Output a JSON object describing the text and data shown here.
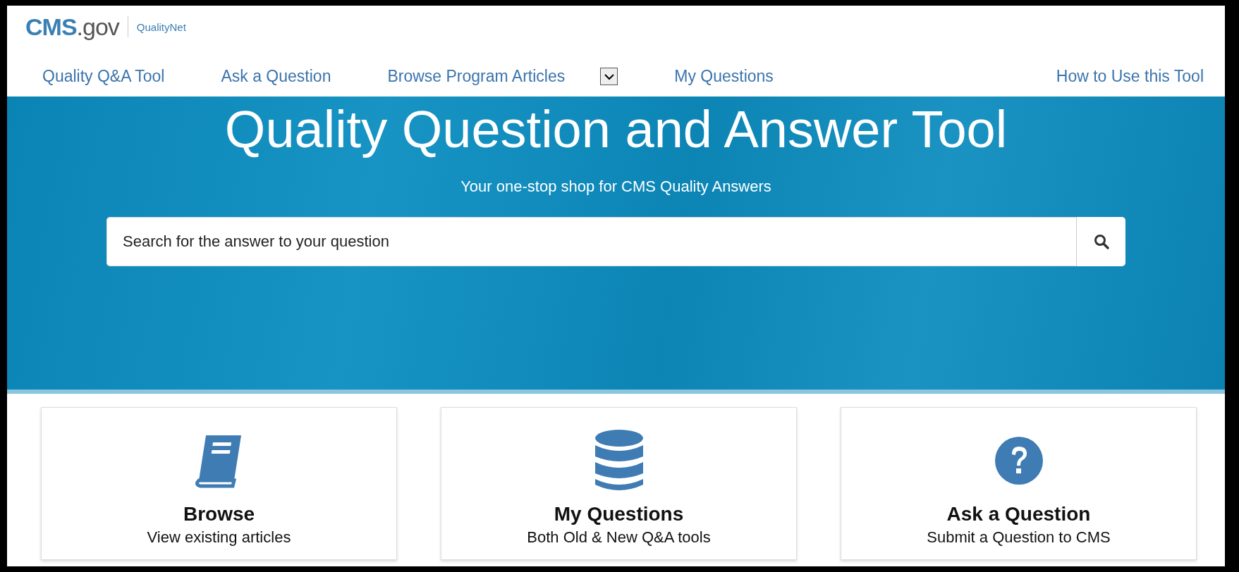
{
  "logo": {
    "brand": "CMS",
    "suffix": ".gov",
    "site": "QualityNet"
  },
  "nav": [
    {
      "label": "Quality Q&A Tool",
      "kind": "link"
    },
    {
      "label": "Ask a Question",
      "kind": "link"
    },
    {
      "label": "Browse Program Articles",
      "kind": "dropdown"
    },
    {
      "label": "My Questions",
      "kind": "link"
    },
    {
      "label": "How to Use this Tool",
      "kind": "link"
    }
  ],
  "hero": {
    "title": "Quality Question and Answer Tool",
    "subtitle": "Your one-stop shop for CMS Quality Answers"
  },
  "search": {
    "placeholder": "Search for the answer to your question"
  },
  "cards": [
    {
      "kind": "book",
      "title": "Browse",
      "text": "View existing articles"
    },
    {
      "kind": "database",
      "title": "My Questions",
      "text": "Both Old & New Q&A tools"
    },
    {
      "kind": "question",
      "title": "Ask a Question",
      "text": "Submit a Question to CMS"
    }
  ]
}
